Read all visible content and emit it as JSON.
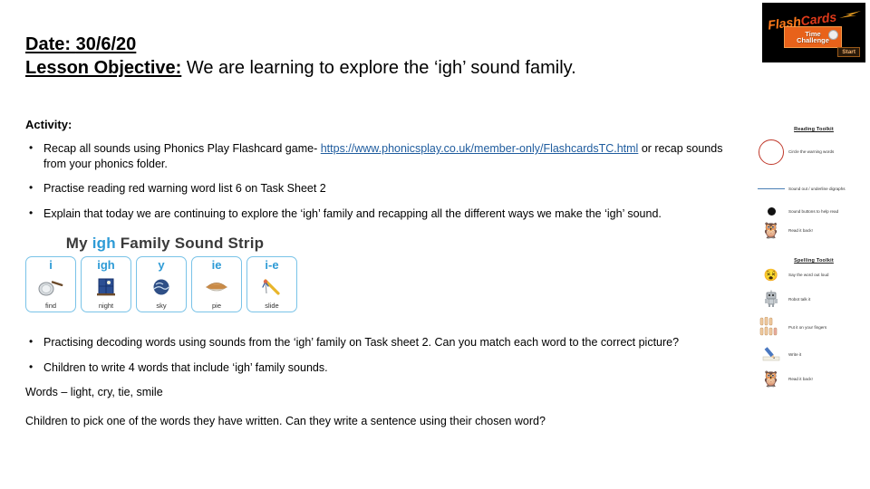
{
  "header": {
    "date_label": "Date:",
    "date_value": "30/6/20",
    "objective_label": "Lesson Objective:",
    "objective_text": "We are learning to explore the ‘igh’ sound family."
  },
  "activity": {
    "title": "Activity:",
    "bullets": [
      {
        "pre": "Recap all sounds using Phonics Play Flashcard game-",
        "link": "https://www.phonicsplay.co.uk/member-only/FlashcardsTC.html",
        "post": "or recap sounds from your phonics folder."
      },
      {
        "pre": "Practise reading red warning word list 6 on Task Sheet 2",
        "link": "",
        "post": ""
      },
      {
        "pre": "Explain that today we are continuing to explore the ‘igh’ family and recapping all the different ways we make the ‘igh’ sound.",
        "link": "",
        "post": ""
      }
    ]
  },
  "sound_strip": {
    "title_pre": "My ",
    "title_highlight": "igh",
    "title_post": " Family Sound Strip",
    "cards": [
      {
        "grapheme": "i",
        "word": "find",
        "icon": "frying-pan-icon",
        "glyph": "🍳"
      },
      {
        "grapheme": "igh",
        "word": "night",
        "icon": "night-window-icon",
        "glyph": "🪟"
      },
      {
        "grapheme": "y",
        "word": "sky",
        "icon": "sky-icon",
        "glyph": "🌍"
      },
      {
        "grapheme": "ie",
        "word": "pie",
        "icon": "pie-icon",
        "glyph": "🥧"
      },
      {
        "grapheme": "i-e",
        "word": "slide",
        "icon": "slide-icon",
        "glyph": "🛹"
      }
    ]
  },
  "bottom": {
    "bullets": [
      "Practising decoding words using sounds from the ‘igh’ family on Task sheet 2. Can you match each word to the correct picture?",
      "Children to write 4 words that include ‘igh’ family sounds."
    ],
    "words_line": "Words – light, cry, tie, smile",
    "closing_line": "Children to pick one of the words they have written. Can they write a sentence using their chosen word?"
  },
  "flashcards_thumb": {
    "title_part1": "Flash",
    "title_part2": "Cards",
    "button_line1": "Time",
    "button_line2": "Challenge",
    "start_label": "Start"
  },
  "toolkit": {
    "reading_title": "Reading Toolkit",
    "reading_items": [
      {
        "icon": "red-circle-icon",
        "text": "Circle the warning words"
      },
      {
        "icon": "underline-icon",
        "text": "Sound out / underline digraphs"
      },
      {
        "icon": "sound-button-dot-icon",
        "text": "Sound buttons to help read"
      },
      {
        "icon": "owl-reading-icon",
        "text": "Read it back!"
      }
    ],
    "spelling_title": "Spelling Toolkit",
    "spelling_items": [
      {
        "icon": "shouting-face-icon",
        "text": "Say the word out loud"
      },
      {
        "icon": "robot-icon",
        "text": "Robot talk it"
      },
      {
        "icon": "fingers-icon",
        "text": "Put it on your fingers"
      },
      {
        "icon": "pencil-icon",
        "text": "Write it"
      },
      {
        "icon": "owl-reading-icon",
        "text": "Read it back!"
      }
    ]
  },
  "colors": {
    "link": "#1f5c9e",
    "strip_accent": "#2e9bd6",
    "strip_border": "#79c3e8",
    "flash_orange": "#ff7a1a",
    "circle_red": "#c0392b"
  }
}
